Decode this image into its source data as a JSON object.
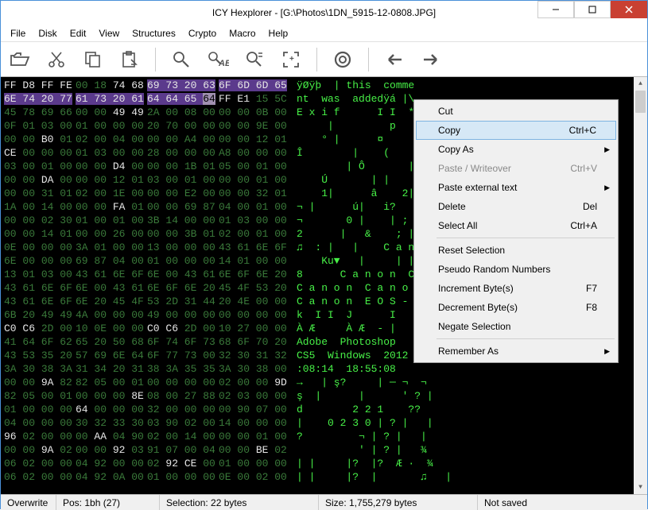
{
  "title": "ICY Hexplorer - [G:\\Photos\\1DN_5915-12-0808.JPG]",
  "menu": [
    "File",
    "Disk",
    "Edit",
    "View",
    "Structures",
    "Crypto",
    "Macro",
    "Help"
  ],
  "hex_rows": [
    {
      "cols": [
        {
          "t": "FF D8 FF FE",
          "c": "wh"
        },
        {
          "t": "00 18 ",
          "c": "dim",
          "s": "74 68",
          "sc": "wh"
        },
        {
          "t": "69 73 20 63",
          "c": "wh",
          "sel": true
        },
        {
          "t": "6F 6D 6D 65",
          "c": "wh",
          "sel": true
        }
      ],
      "ascii": "ÿØÿþ  | this  comme"
    },
    {
      "cols": [
        {
          "t": "6E 74 20 77",
          "c": "wh",
          "sel": true
        },
        {
          "t": "61 73 20 61",
          "c": "wh",
          "sel": true
        },
        {
          "t": "64 64 65 ",
          "c": "wh",
          "sel": true,
          "cur": "64"
        },
        {
          "t": "FF E1 ",
          "c": "wh",
          "s": "15 5C",
          "sc": "dim"
        }
      ],
      "ascii": "nt  was  addedÿá |\\"
    },
    {
      "cols": [
        {
          "t": "45 78 69 66",
          "c": "dim"
        },
        {
          "t": "00 00 ",
          "c": "dim",
          "s": "49 49",
          "sc": "wh"
        },
        {
          "t": "2A 00 ",
          "c": "dim",
          "s": "08 00",
          "sc": "dim"
        },
        {
          "t": "00 00 ",
          "c": "dim",
          "s": "0B 00",
          "sc": "dim"
        }
      ],
      "ascii": "E x i f      I I  *"
    },
    {
      "cols": [
        {
          "t": "0F 01 03 00",
          "c": "dim"
        },
        {
          "t": "01 00 00 00",
          "c": "dim"
        },
        {
          "t": "20 70 00 00",
          "c": "dim"
        },
        {
          "t": "00 00 ",
          "c": "dim",
          "s": "9E 00",
          "sc": "dim"
        }
      ],
      "ascii": "     |         p"
    },
    {
      "cols": [
        {
          "t": "00 00 ",
          "c": "dim",
          "s": "B0 ",
          "sc": "wh",
          "s2": "01",
          "s2c": "dim"
        },
        {
          "t": "02 00 ",
          "c": "dim",
          "s": "04 00",
          "sc": "dim"
        },
        {
          "t": "00 00 ",
          "c": "dim",
          "s": "A4 00",
          "sc": "dim"
        },
        {
          "t": "00 00 ",
          "c": "dim",
          "s": "12 01",
          "sc": "dim"
        }
      ],
      "ascii": "    ° |      ¤       | |"
    },
    {
      "cols": [
        {
          "t": "CE ",
          "c": "wh",
          "s": "00 00 00",
          "sc": "dim"
        },
        {
          "t": "01 03 00 00",
          "c": "dim"
        },
        {
          "t": "28 00 00 00",
          "c": "dim"
        },
        {
          "t": "A8 00 00 00",
          "c": "dim"
        }
      ],
      "ascii": "Î        |    (      ¨"
    },
    {
      "cols": [
        {
          "t": "03 00 ",
          "c": "dim",
          "s": "01 00",
          "sc": "dim"
        },
        {
          "t": "00 00 ",
          "c": "dim",
          "s": "D4 ",
          "sc": "wh",
          "s2": "00",
          "s2c": "dim"
        },
        {
          "t": "00 00 ",
          "c": "dim",
          "s": "1B 01",
          "sc": "dim"
        },
        {
          "t": "05 00 ",
          "c": "dim",
          "s": "01 00",
          "sc": "dim"
        }
      ],
      "ascii": "        | Ô       | |"
    },
    {
      "cols": [
        {
          "t": "00 00 ",
          "c": "dim",
          "s": "DA ",
          "sc": "wh",
          "s2": "00",
          "s2c": "dim"
        },
        {
          "t": "00 00 ",
          "c": "dim",
          "s": "12 01",
          "sc": "dim"
        },
        {
          "t": "03 00 ",
          "c": "dim",
          "s": "01 00",
          "sc": "dim"
        },
        {
          "t": "00 00 ",
          "c": "dim",
          "s": "01 00",
          "sc": "dim"
        }
      ],
      "ascii": "    Ú       | |"
    },
    {
      "cols": [
        {
          "t": "00 00 ",
          "c": "dim",
          "s": "31 01",
          "sc": "dim"
        },
        {
          "t": "02 00 ",
          "c": "dim",
          "s": "1E 00",
          "sc": "dim"
        },
        {
          "t": "00 00 ",
          "c": "dim",
          "s": "E2 00",
          "sc": "dim"
        },
        {
          "t": "00 00 ",
          "c": "dim",
          "s": "32 01",
          "sc": "dim"
        }
      ],
      "ascii": "    1|      â    2|"
    },
    {
      "cols": [
        {
          "t": "1A 00 ",
          "c": "dim",
          "s": "14 00",
          "sc": "dim"
        },
        {
          "t": "00 00 ",
          "c": "dim",
          "s": "FA ",
          "sc": "wh",
          "s2": "01",
          "s2c": "dim"
        },
        {
          "t": "00 00 ",
          "c": "dim",
          "s": "69 ",
          "sc": "dim",
          "s2": "87",
          "s2c": "dim"
        },
        {
          "t": "04 00 ",
          "c": "dim",
          "s": "01 00",
          "sc": "dim"
        }
      ],
      "ascii": "¬ |      ú|   i?    |"
    },
    {
      "cols": [
        {
          "t": "00 00 ",
          "c": "dim",
          "s": "02 30",
          "sc": "dim"
        },
        {
          "t": "01 00 ",
          "c": "dim",
          "s": "01 00",
          "sc": "dim"
        },
        {
          "t": "3B 14 00 00",
          "c": "dim"
        },
        {
          "t": "01 03 00 00",
          "c": "dim"
        }
      ],
      "ascii": "¬       0 |    | ;"
    },
    {
      "cols": [
        {
          "t": "00 00 ",
          "c": "dim",
          "s": "14 01",
          "sc": "dim"
        },
        {
          "t": "00 00 ",
          "c": "dim",
          "s": "26 00",
          "sc": "dim"
        },
        {
          "t": "00 00 ",
          "c": "dim",
          "s": "3B ",
          "sc": "dim",
          "s2": "01",
          "s2c": "dim"
        },
        {
          "t": "02 00 ",
          "c": "dim",
          "s": "01 00",
          "sc": "dim"
        }
      ],
      "ascii": "2      |   &    ; |"
    },
    {
      "cols": [
        {
          "t": "0E 00 00 00",
          "c": "dim"
        },
        {
          "t": "3A 01 00 00",
          "c": "dim"
        },
        {
          "t": "13 00 00 00",
          "c": "dim"
        },
        {
          "t": "43 61 6E 6F",
          "c": "dim"
        }
      ],
      "ascii": "♫  : |   |    C a n o"
    },
    {
      "cols": [
        {
          "t": "6E 00 ",
          "c": "dim",
          "s": "00 00",
          "sc": "dim"
        },
        {
          "t": "69 87 ",
          "c": "dim",
          "s": "04 00",
          "sc": "dim"
        },
        {
          "t": "01 00 00 00",
          "c": "dim"
        },
        {
          "t": "14 01 00 00",
          "c": "dim"
        }
      ],
      "ascii": "    Ku▼   |     | ||"
    },
    {
      "cols": [
        {
          "t": "13 ",
          "c": "dim",
          "s": "01 ",
          "sc": "dim",
          "s2": "03 00",
          "s2c": "dim"
        },
        {
          "t": "43 61 ",
          "c": "dim",
          "s": "6E 6F",
          "sc": "dim"
        },
        {
          "t": "6E 00 ",
          "c": "dim",
          "s": "43 61",
          "sc": "dim"
        },
        {
          "t": "6E 6F ",
          "c": "dim",
          "s": "6E 20",
          "sc": "dim"
        }
      ],
      "ascii": "8      C a n o n  C a n"
    },
    {
      "cols": [
        {
          "t": "43 61 ",
          "c": "dim",
          "s": "6E 6F",
          "sc": "dim"
        },
        {
          "t": "6E 00 ",
          "c": "dim",
          "s": "43 61",
          "sc": "dim"
        },
        {
          "t": "6E 6F 6E 20",
          "c": "dim"
        },
        {
          "t": "45 4F 53 20",
          "c": "dim"
        }
      ],
      "ascii": "C a n o n  C a n o n  E O"
    },
    {
      "cols": [
        {
          "t": "43 61 6E 6F",
          "c": "dim"
        },
        {
          "t": "6E 20 45 4F",
          "c": "dim"
        },
        {
          "t": "53 2D 31 44",
          "c": "dim"
        },
        {
          "t": "20 4E 00 00",
          "c": "dim"
        }
      ],
      "ascii": "C a n o n  E O S - 1 D  N"
    },
    {
      "cols": [
        {
          "t": "6B 20 ",
          "c": "dim",
          "s": "49 49",
          "sc": "dim"
        },
        {
          "t": "4A 00 00 00",
          "c": "dim"
        },
        {
          "t": "49 00 00 00",
          "c": "dim"
        },
        {
          "t": "00 00 00 00",
          "c": "dim"
        }
      ],
      "ascii": "k  I I  J      I"
    },
    {
      "cols": [
        {
          "t": "C0 C6 ",
          "c": "wh",
          "s": "2D 00",
          "sc": "dim"
        },
        {
          "t": "10 0E ",
          "c": "dim",
          "s": "00 00",
          "sc": "dim"
        },
        {
          "t": "C0 C6 ",
          "c": "wh",
          "s": "2D 00",
          "sc": "dim"
        },
        {
          "t": "10 27 00 00",
          "c": "dim"
        }
      ],
      "ascii": "À Æ     À Æ  - |"
    },
    {
      "cols": [
        {
          "t": "41 64 6F 62",
          "c": "dim"
        },
        {
          "t": "65 20 ",
          "c": "dim",
          "s": "50 68",
          "sc": "dim"
        },
        {
          "t": "6F 74 6F 73",
          "c": "dim"
        },
        {
          "t": "68 6F 70 20",
          "c": "dim"
        }
      ],
      "ascii": "Adobe  Photoshop"
    },
    {
      "cols": [
        {
          "t": "43 53 ",
          "c": "dim",
          "s": "35 20",
          "sc": "dim"
        },
        {
          "t": "57 ",
          "c": "dim",
          "s": "69 6E 64",
          "sc": "dim"
        },
        {
          "t": "6F 77 ",
          "c": "dim",
          "s": "73 00",
          "sc": "dim"
        },
        {
          "t": "32 30 ",
          "c": "dim",
          "s": "31 32",
          "sc": "dim"
        }
      ],
      "ascii": "CS5  Windows  2012"
    },
    {
      "cols": [
        {
          "t": "3A 30 ",
          "c": "dim",
          "s": "38 3A",
          "sc": "dim"
        },
        {
          "t": "31 34 ",
          "c": "dim",
          "s": "20 31",
          "sc": "dim"
        },
        {
          "t": "38 3A ",
          "c": "dim",
          "s": "35 35",
          "sc": "dim"
        },
        {
          "t": "3A 30 ",
          "c": "dim",
          "s": "38 00",
          "sc": "dim"
        }
      ],
      "ascii": ":08:14  18:55:08"
    },
    {
      "cols": [
        {
          "t": "00 00 ",
          "c": "dim",
          "s": "9A ",
          "sc": "wh",
          "s2": "82",
          "s2c": "dim"
        },
        {
          "t": "82 ",
          "c": "dim",
          "s": "05 00 01",
          "sc": "dim"
        },
        {
          "t": "00 00 00 00",
          "c": "dim"
        },
        {
          "t": "02 00 00 ",
          "c": "dim",
          "s": "9D",
          "sc": "wh"
        }
      ],
      "ascii": "→   | ş?     | ─ ¬  ¬"
    },
    {
      "cols": [
        {
          "t": "82 ",
          "c": "dim",
          "s": "05 00 01",
          "sc": "dim"
        },
        {
          "t": "00 00 00 ",
          "c": "dim",
          "s": "8E",
          "sc": "wh"
        },
        {
          "t": "08 00 ",
          "c": "dim",
          "s": "27 88",
          "sc": "dim"
        },
        {
          "t": "02 03 00 00",
          "c": "dim"
        }
      ],
      "ascii": "ş  |      |      ' ? |"
    },
    {
      "cols": [
        {
          "t": "01 00 00 00",
          "c": "dim"
        },
        {
          "t": "64 ",
          "c": "wh",
          "s": "00 00 00",
          "sc": "dim"
        },
        {
          "t": "32 00 ",
          "c": "dim",
          "s": "00 00",
          "sc": "dim"
        },
        {
          "t": "00 90 ",
          "c": "dim",
          "s": "07 00",
          "sc": "dim"
        }
      ],
      "ascii": "d        2 2 1    ??"
    },
    {
      "cols": [
        {
          "t": "04 00 00 00",
          "c": "dim"
        },
        {
          "t": "30 32 ",
          "c": "dim",
          "s": "33 30",
          "sc": "dim"
        },
        {
          "t": "03 90 ",
          "c": "dim",
          "s": "02 00",
          "sc": "dim"
        },
        {
          "t": "14 00 ",
          "c": "dim",
          "s": "00 00",
          "sc": "dim"
        }
      ],
      "ascii": "|    0 2 3 0 | ? |   |"
    },
    {
      "cols": [
        {
          "t": "96 ",
          "c": "wh",
          "s": "02 00 00",
          "sc": "dim"
        },
        {
          "t": "00 ",
          "c": "dim",
          "s": "AA ",
          "sc": "wh",
          "s2": "04 90",
          "s2c": "dim"
        },
        {
          "t": "02 00 ",
          "c": "dim",
          "s": "14 00",
          "sc": "dim"
        },
        {
          "t": "00 00 ",
          "c": "dim",
          "s": "01 00",
          "sc": "dim"
        }
      ],
      "ascii": "?         ¬ | ? |   |"
    },
    {
      "cols": [
        {
          "t": "00 00 ",
          "c": "dim",
          "s": "9A ",
          "sc": "wh",
          "s2": "02",
          "s2c": "dim"
        },
        {
          "t": "00 00 ",
          "c": "dim",
          "s": "92 ",
          "sc": "wh",
          "s2": "03",
          "s2c": "dim"
        },
        {
          "t": "91 ",
          "c": "dim",
          "s": "07 00 04",
          "sc": "dim"
        },
        {
          "t": "00 00 ",
          "c": "dim",
          "s": "BE ",
          "sc": "wh",
          "s2": "02",
          "s2c": "dim"
        }
      ],
      "ascii": "          ' | ? |   ¾"
    },
    {
      "cols": [
        {
          "t": "06 02 ",
          "c": "dim",
          "s": "00 00",
          "sc": "dim"
        },
        {
          "t": "04 92 ",
          "c": "dim",
          "s": "00 00",
          "sc": "dim"
        },
        {
          "t": "02 ",
          "c": "dim",
          "s": "92 ",
          "sc": "wh",
          "s2": "CE ",
          "s2c": "wh",
          "s3": "00",
          "s3c": "dim"
        },
        {
          "t": "01 00 ",
          "c": "dim",
          "s": "00 00",
          "sc": "dim"
        }
      ],
      "ascii": "| |     |?  |?  Æ ·  ¾"
    },
    {
      "cols": [
        {
          "t": "06 02 ",
          "c": "dim",
          "s": "00 00",
          "sc": "dim"
        },
        {
          "t": "04 92 ",
          "c": "dim",
          "s": "0A 00",
          "sc": "dim"
        },
        {
          "t": "01 00 ",
          "c": "dim",
          "s": "00 00",
          "sc": "dim"
        },
        {
          "t": "0E 00 ",
          "c": "dim",
          "s": "02 00",
          "sc": "dim"
        }
      ],
      "ascii": "| |     |?  |       ♫   |"
    }
  ],
  "context_menu": [
    {
      "label": "Cut",
      "type": "item"
    },
    {
      "label": "Copy",
      "shortcut": "Ctrl+C",
      "type": "item",
      "hover": true
    },
    {
      "label": "Copy As",
      "type": "submenu"
    },
    {
      "label": "Paste / Writeover",
      "shortcut": "Ctrl+V",
      "type": "item",
      "disabled": true
    },
    {
      "label": "Paste external text",
      "type": "submenu"
    },
    {
      "label": "Delete",
      "shortcut": "Del",
      "type": "item"
    },
    {
      "label": "Select All",
      "shortcut": "Ctrl+A",
      "type": "item"
    },
    {
      "type": "sep"
    },
    {
      "label": "Reset Selection",
      "type": "item"
    },
    {
      "label": "Pseudo Random Numbers",
      "type": "item"
    },
    {
      "label": "Increment Byte(s)",
      "shortcut": "F7",
      "type": "item"
    },
    {
      "label": "Decrement Byte(s)",
      "shortcut": "F8",
      "type": "item"
    },
    {
      "label": "Negate Selection",
      "type": "item"
    },
    {
      "type": "sep"
    },
    {
      "label": "Remember As",
      "type": "submenu"
    }
  ],
  "status": {
    "mode": "Overwrite",
    "pos": "Pos: 1bh (27)",
    "sel": "Selection: 22 bytes",
    "size": "Size: 1,755,279 bytes",
    "saved": "Not saved"
  }
}
